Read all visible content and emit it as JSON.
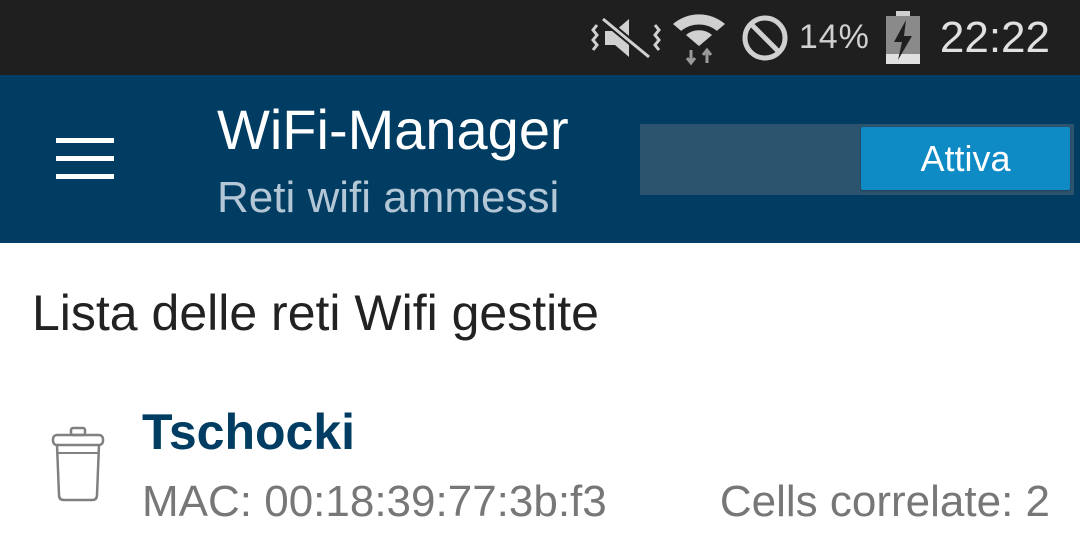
{
  "status_bar": {
    "battery_percent": "14%",
    "clock": "22:22",
    "icons": [
      "vibrate-off-icon",
      "wifi-data-icon",
      "do-not-disturb-icon",
      "battery-charging-icon"
    ]
  },
  "app_bar": {
    "title": "WiFi-Manager",
    "subtitle": "Reti wifi ammessi",
    "toggle_label": "Attiva",
    "color": "#013d62",
    "accent": "#0e8ac5"
  },
  "content": {
    "section_title": "Lista delle reti Wifi gestite",
    "networks": [
      {
        "name": "Tschocki",
        "mac": "MAC: 00:18:39:77:3b:f3",
        "cells": "Cells correlate: 2"
      }
    ]
  }
}
